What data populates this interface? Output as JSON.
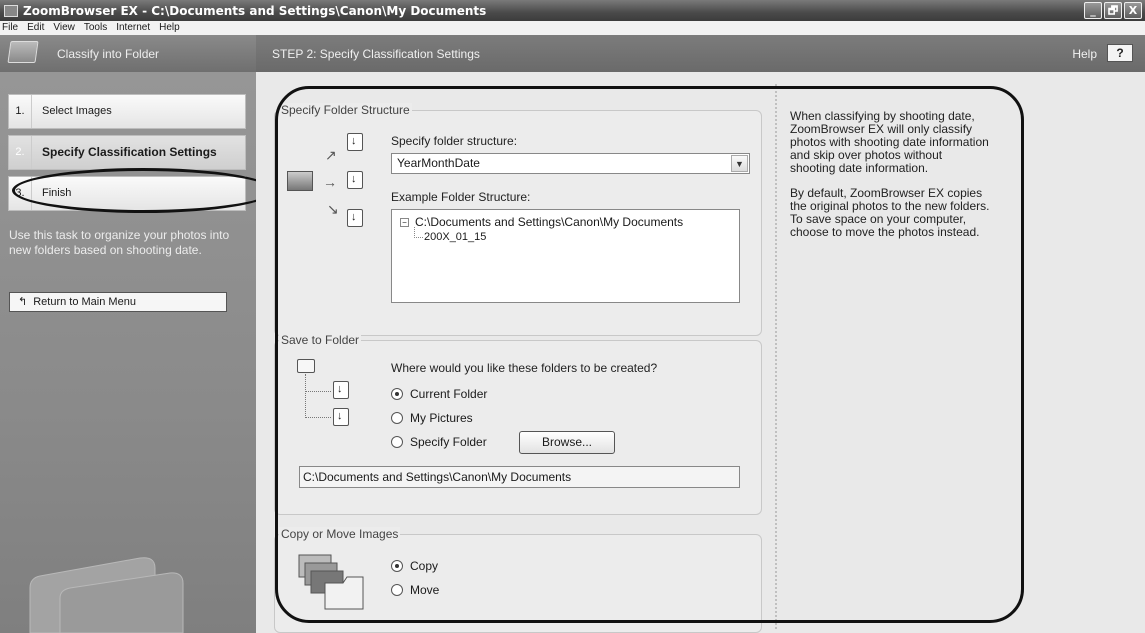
{
  "window": {
    "title": "ZoomBrowser EX  -  C:\\Documents and Settings\\Canon\\My Documents",
    "buttons": [
      "_",
      "🗗",
      "X"
    ]
  },
  "menu": [
    "File",
    "Edit",
    "View",
    "Tools",
    "Internet",
    "Help"
  ],
  "header": {
    "task_title": "Classify into Folder",
    "step_title": "STEP 2: Specify Classification Settings",
    "help_label": "Help",
    "help_button": "?"
  },
  "sidebar": {
    "steps": [
      {
        "num": "1.",
        "label": "Select Images"
      },
      {
        "num": "2.",
        "label": "Specify Classification Settings"
      },
      {
        "num": "3.",
        "label": "Finish"
      }
    ],
    "description": "Use this task to organize your photos into new folders based on shooting date.",
    "return_button": "Return to Main Menu"
  },
  "folder_structure": {
    "legend": "Specify Folder Structure",
    "label": "Specify folder structure:",
    "selected": "YearMonthDate",
    "example_label": "Example Folder Structure:",
    "tree_root": "C:\\Documents and Settings\\Canon\\My Documents",
    "tree_child": "200X_01_15"
  },
  "save_to": {
    "legend": "Save to Folder",
    "question": "Where would you like these folders to be created?",
    "options": [
      "Current Folder",
      "My Pictures",
      "Specify Folder"
    ],
    "selected_index": 0,
    "browse_button": "Browse...",
    "path": "C:\\Documents and Settings\\Canon\\My Documents"
  },
  "copy_move": {
    "legend": "Copy or Move Images",
    "options": [
      "Copy",
      "Move"
    ],
    "selected_index": 0
  },
  "info": {
    "p1": "When classifying by shooting date, ZoomBrowser EX will only classify photos with shooting date information and skip over photos without shooting date information.",
    "p2": "By default, ZoomBrowser EX copies the original photos to the new folders. To save space on your computer, choose to move the photos instead."
  }
}
